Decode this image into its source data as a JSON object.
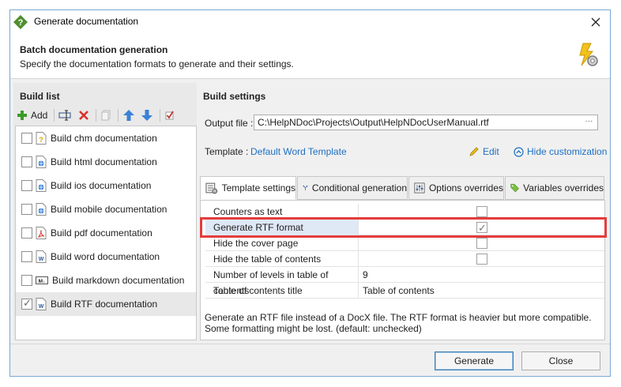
{
  "window": {
    "title": "Generate documentation"
  },
  "header": {
    "title": "Batch documentation generation",
    "subtitle": "Specify the documentation formats to generate and their settings."
  },
  "build_list": {
    "title": "Build list",
    "add_label": "Add",
    "items": [
      {
        "label": "Build chm documentation",
        "checked": false,
        "icon": "chm-file-icon"
      },
      {
        "label": "Build html documentation",
        "checked": false,
        "icon": "html-file-icon"
      },
      {
        "label": "Build ios documentation",
        "checked": false,
        "icon": "ios-file-icon"
      },
      {
        "label": "Build mobile documentation",
        "checked": false,
        "icon": "mobile-file-icon"
      },
      {
        "label": "Build pdf documentation",
        "checked": false,
        "icon": "pdf-file-icon"
      },
      {
        "label": "Build word documentation",
        "checked": false,
        "icon": "word-file-icon"
      },
      {
        "label": "Build markdown documentation",
        "checked": false,
        "icon": "markdown-file-icon"
      },
      {
        "label": "Build RTF documentation",
        "checked": true,
        "selected": true,
        "icon": "rtf-file-icon"
      }
    ]
  },
  "build_settings": {
    "title": "Build settings",
    "output_label": "Output file :",
    "output_value": "C:\\HelpNDoc\\Projects\\Output\\HelpNDocUserManual.rtf",
    "ellipsis": "···",
    "template_label": "Template :",
    "template_value": "Default Word Template",
    "edit_label": "Edit",
    "hide_customization_label": "Hide customization",
    "tabs": [
      {
        "label": "Template settings",
        "active": true
      },
      {
        "label": "Conditional generation",
        "active": false
      },
      {
        "label": "Options overrides",
        "active": false
      },
      {
        "label": "Variables overrides",
        "active": false
      }
    ],
    "properties": [
      {
        "name": "Counters as text",
        "type": "checkbox",
        "checked": false
      },
      {
        "name": "Generate RTF format",
        "type": "checkbox",
        "checked": true,
        "selected": true
      },
      {
        "name": "Hide the cover page",
        "type": "checkbox",
        "checked": false
      },
      {
        "name": "Hide the table of contents",
        "type": "checkbox",
        "checked": false
      },
      {
        "name": "Number of levels in table of contents",
        "type": "text",
        "value": "9"
      },
      {
        "name": "Table of contents title",
        "type": "text",
        "value": "Table of contents"
      }
    ],
    "description": "Generate an RTF file instead of a DocX file. The RTF format is heavier but more compatible. Some formatting might be lost. (default: unchecked)"
  },
  "footer": {
    "generate_label": "Generate",
    "close_label": "Close"
  },
  "colors": {
    "accent": "#1e6fc1",
    "highlight": "#e53c3c",
    "window_border": "#7aa7d6"
  }
}
